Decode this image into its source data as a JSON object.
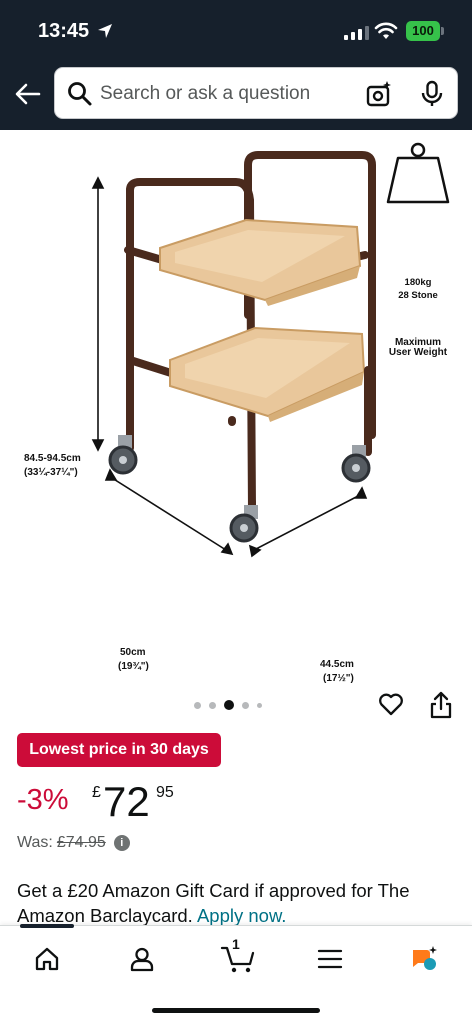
{
  "status_bar": {
    "time": "13:45",
    "battery": "100"
  },
  "search": {
    "placeholder": "Search or ask a question"
  },
  "product_image": {
    "capacity_weight": "180kg",
    "capacity_stone": "28 Stone",
    "capacity_caption_line1": "Maximum",
    "capacity_caption_line2": "User Weight",
    "height_metric": "84.5-94.5cm",
    "height_imperial": "(33¼-37¼\")",
    "width_metric": "50cm",
    "width_imperial": "(19¾\")",
    "depth_metric": "44.5cm",
    "depth_imperial": "(17½\")"
  },
  "carousel": {
    "total": 5,
    "active_index": 2
  },
  "deal": {
    "badge": "Lowest price in 30 days"
  },
  "price": {
    "discount": "-3%",
    "currency": "£",
    "whole": "72",
    "fraction": "95",
    "was_label": "Was:",
    "was_price": "£74.95"
  },
  "promo": {
    "text": "Get a £20 Amazon Gift Card if approved for The Amazon Barclaycard.",
    "link": "Apply now."
  },
  "tabbar": {
    "cart_count": "1"
  },
  "colors": {
    "header": "#16202c",
    "deal_red": "#cc0c39",
    "link": "#007185",
    "tray": "#e9c79b",
    "frame": "#4a2a1d"
  }
}
